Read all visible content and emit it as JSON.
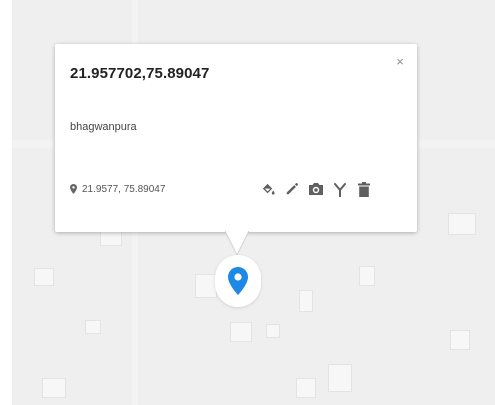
{
  "map": {
    "background_color": "#efefef",
    "marker_color": "#1e88e5"
  },
  "popup": {
    "title": "21.957702,75.89047",
    "close_label": "×",
    "description": "bhagwanpura",
    "coordinates": "21.9577, 75.89047",
    "icons": {
      "location": "map-pin-icon",
      "toolbar": [
        "paint-bucket-icon",
        "pencil-icon",
        "camera-icon",
        "route-icon",
        "trash-icon"
      ]
    }
  }
}
